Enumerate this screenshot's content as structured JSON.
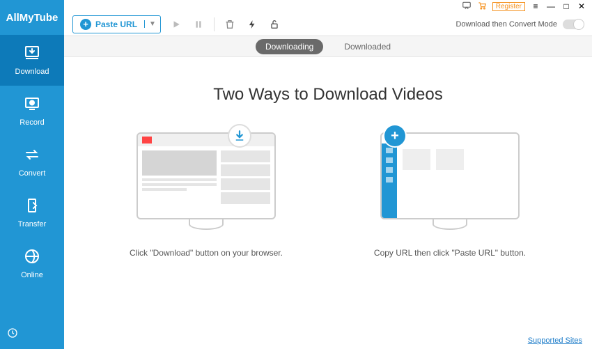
{
  "app_name": "AllMyTube",
  "sidebar": {
    "items": [
      {
        "label": "Download"
      },
      {
        "label": "Record"
      },
      {
        "label": "Convert"
      },
      {
        "label": "Transfer"
      },
      {
        "label": "Online"
      }
    ]
  },
  "toolbar": {
    "paste_label": "Paste URL",
    "convert_mode_label": "Download then Convert Mode"
  },
  "titlebar": {
    "register": "Register"
  },
  "tabs": {
    "downloading": "Downloading",
    "downloaded": "Downloaded"
  },
  "content": {
    "heading": "Two Ways to Download Videos",
    "card1_caption": "Click \"Download\" button on your browser.",
    "card2_caption": "Copy URL then click \"Paste URL\" button."
  },
  "footer": {
    "supported_sites": "Supported Sites"
  }
}
